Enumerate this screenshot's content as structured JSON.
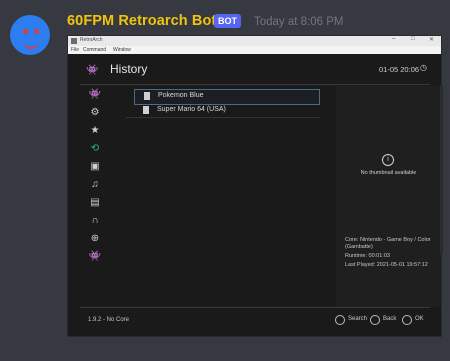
{
  "message": {
    "author": "60FPM Retroarch Bot",
    "badge": "BOT",
    "timestamp": "Today at 8:06 PM"
  },
  "window": {
    "title": "RetroArch",
    "menu": [
      "File",
      "Command",
      "Window"
    ],
    "controls": [
      "–",
      "□",
      "✕"
    ]
  },
  "retroarch": {
    "header_title": "History",
    "time": "01-05 20:06",
    "sidebar_icons": [
      "retroarch-logo-icon",
      "settings-gear-icon",
      "favorites-star-icon",
      "history-icon",
      "images-icon",
      "music-icon",
      "video-icon",
      "netplay-icon",
      "add-icon",
      "controller-icon"
    ],
    "history_items": [
      {
        "label": "Pokemon Blue",
        "selected": true
      },
      {
        "label": "Super Mario 64 (USA)",
        "selected": false
      }
    ],
    "thumbnail_text": "No thumbnail available",
    "core_info": "Core: Nintendo - Game Boy / Color (Gambatte)",
    "runtime": "Runtime: 00:01:03",
    "last_played": "Last Played: 2021-05-01 19:57:12",
    "version": "1.9.2 - No Core",
    "footer_buttons": [
      "Search",
      "Back",
      "OK"
    ]
  }
}
